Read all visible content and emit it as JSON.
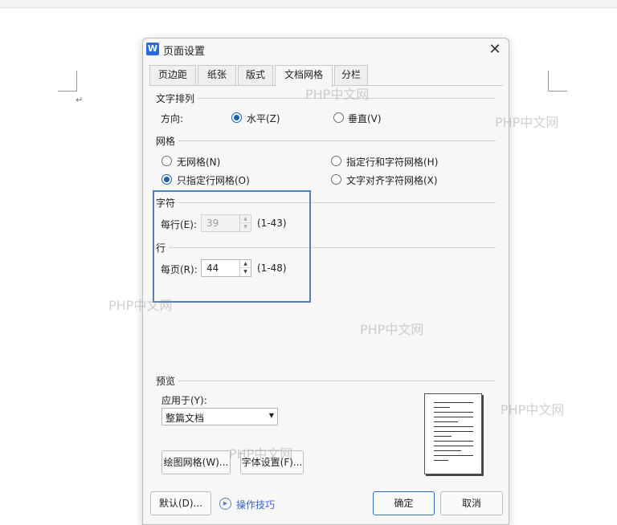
{
  "dialog": {
    "app_icon": "W",
    "title": "页面设置"
  },
  "tabs": [
    {
      "label": "页边距"
    },
    {
      "label": "纸张"
    },
    {
      "label": "版式"
    },
    {
      "label": "文档网格",
      "active": true
    },
    {
      "label": "分栏"
    }
  ],
  "text_layout": {
    "group_label": "文字排列",
    "direction_label": "方向:",
    "horizontal": "水平(Z)",
    "vertical": "垂直(V)",
    "selected": "horizontal"
  },
  "grid": {
    "group_label": "网格",
    "no_grid": "无网格(N)",
    "line_and_char": "指定行和字符网格(H)",
    "line_only": "只指定行网格(O)",
    "align_char": "文字对齐字符网格(X)",
    "selected": "line_only"
  },
  "chars": {
    "group_label": "字符",
    "per_line_label": "每行(E):",
    "per_line_value": "39",
    "per_line_range": "(1-43)",
    "disabled": true
  },
  "lines": {
    "group_label": "行",
    "per_page_label": "每页(R):",
    "per_page_value": "44",
    "per_page_range": "(1-48)"
  },
  "preview": {
    "group_label": "预览",
    "apply_label": "应用于(Y):",
    "apply_value": "整篇文档"
  },
  "buttons": {
    "draw_grid": "绘图网格(W)...",
    "font_settings": "字体设置(F)...",
    "default": "默认(D)...",
    "tips": "操作技巧",
    "ok": "确定",
    "cancel": "取消"
  },
  "watermark": "PHP中文网",
  "colors": {
    "accent": "#1d5fa8",
    "highlight_box": "#4f7fb9",
    "link": "#3a66b6"
  }
}
